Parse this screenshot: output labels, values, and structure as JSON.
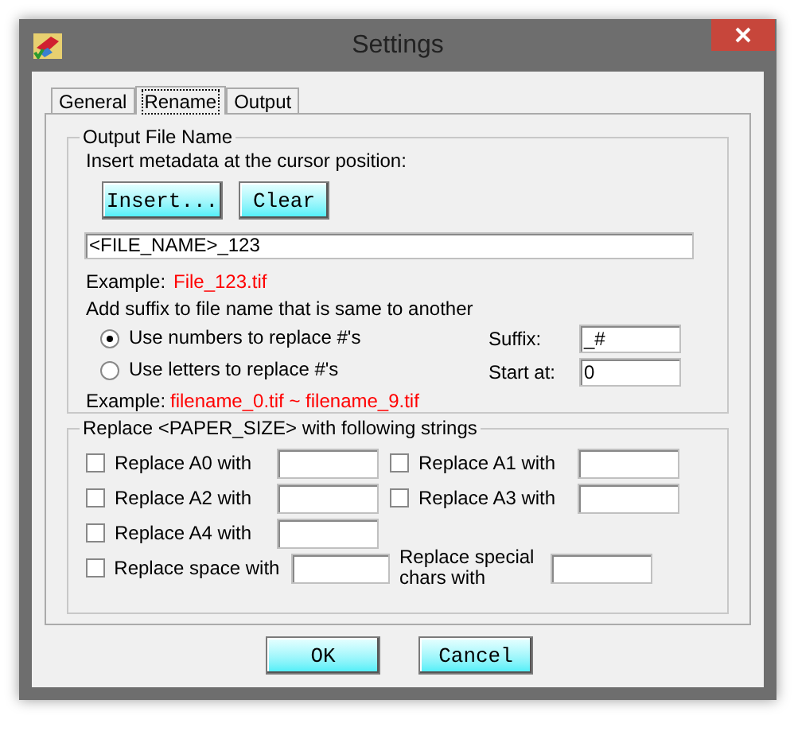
{
  "window": {
    "title": "Settings"
  },
  "tabs": [
    {
      "label": "General",
      "selected": false
    },
    {
      "label": "Rename",
      "selected": true
    },
    {
      "label": "Output",
      "selected": false
    }
  ],
  "output_file_name": {
    "title": "Output File Name",
    "instruction": "Insert metadata at the cursor position:",
    "buttons": [
      "Insert...",
      "Clear"
    ],
    "pattern": "<FILE_NAME>_123",
    "example_label": "Example:",
    "example": "File_123.tif",
    "suffix_hint": "Add suffix to file name that is same to another",
    "options": [
      {
        "label": "Use numbers to replace #'s",
        "selected": true
      },
      {
        "label": "Use letters to replace #'s",
        "selected": false
      }
    ],
    "suffix": {
      "label": "Suffix:",
      "value": "_#"
    },
    "start_at": {
      "label": "Start at:",
      "value": "0"
    },
    "example2_label": "Example:",
    "example2": "filename_0.tif ~ filename_9.tif"
  },
  "paper_size": {
    "title": "Replace <PAPER_SIZE> with following strings",
    "rows": [
      [
        {
          "kind": "checkbox",
          "label": "Replace A0 with",
          "checked": false
        },
        {
          "kind": "checkbox",
          "label": "Replace A1 with",
          "checked": false
        }
      ],
      [
        {
          "kind": "checkbox",
          "label": "Replace A2 with",
          "checked": false
        },
        {
          "kind": "checkbox",
          "label": "Replace A3 with",
          "checked": false
        }
      ],
      [
        {
          "kind": "checkbox",
          "label": "Replace A4 with",
          "checked": false
        }
      ],
      [
        {
          "kind": "checkbox",
          "label": "Replace space with",
          "checked": false
        },
        {
          "kind": "plain",
          "label": "Replace special chars with"
        }
      ]
    ]
  },
  "buttons": [
    "OK",
    "Cancel"
  ]
}
